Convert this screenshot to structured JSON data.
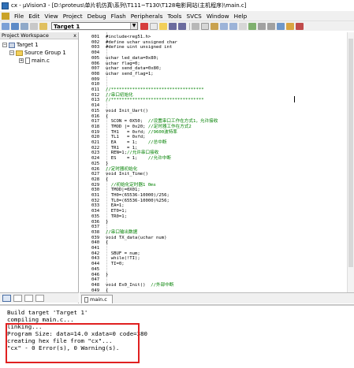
{
  "window": {
    "title": "cx - µVision3 - [D:\\proteus\\单片机仿真\\系列\\T111~T130\\T128电影网站(主机程序)\\main.c]"
  },
  "menu": [
    {
      "label": "File"
    },
    {
      "label": "Edit"
    },
    {
      "label": "View"
    },
    {
      "label": "Project"
    },
    {
      "label": "Debug"
    },
    {
      "label": "Flash"
    },
    {
      "label": "Peripherals"
    },
    {
      "label": "Tools"
    },
    {
      "label": "SVCS"
    },
    {
      "label": "Window"
    },
    {
      "label": "Help"
    }
  ],
  "toolbar": {
    "target_value": "Target 1"
  },
  "project_pane": {
    "header": "Project Workspace",
    "close_glyph": "x",
    "tree": [
      {
        "label": "Target 1",
        "level": 0,
        "expanded": true
      },
      {
        "label": "Source Group 1",
        "level": 1,
        "expanded": true
      },
      {
        "label": "main.c",
        "level": 2,
        "expanded": false
      }
    ]
  },
  "editor": {
    "lines": [
      {
        "no": "001",
        "text": "#include<reg51.h>"
      },
      {
        "no": "002",
        "text": "#define uchar unsigned char"
      },
      {
        "no": "003",
        "text": "#define uint unsigned int"
      },
      {
        "no": "004",
        "text": ""
      },
      {
        "no": "005",
        "text": "uchar led_data=0x80;"
      },
      {
        "no": "006",
        "text": "uchar flag=0;"
      },
      {
        "no": "007",
        "text": "uchar send_data=0x80;"
      },
      {
        "no": "008",
        "text": "uchar send_flag=1;"
      },
      {
        "no": "009",
        "text": ""
      },
      {
        "no": "010",
        "text": ""
      },
      {
        "no": "011",
        "text": "//***********************************"
      },
      {
        "no": "012",
        "text": "//串口初始化"
      },
      {
        "no": "013",
        "text": "//***********************************"
      },
      {
        "no": "014",
        "text": ""
      },
      {
        "no": "015",
        "text": "void Init_Uart()"
      },
      {
        "no": "016",
        "text": "{"
      },
      {
        "no": "017",
        "text": "  SCON = 0X50;  //设置串口工作在方式1，允许接收"
      },
      {
        "no": "018",
        "text": "  TMOD |= 0x20; //定时器工作在方式2"
      },
      {
        "no": "019",
        "text": "  TH1   = 0xfd; //9600波特率"
      },
      {
        "no": "020",
        "text": "  TL1   = 0xfd;"
      },
      {
        "no": "021",
        "text": "  EA    = 1;    //总中断"
      },
      {
        "no": "022",
        "text": "  TR1   = 1;"
      },
      {
        "no": "023",
        "text": "  REN=1;//允许串口接收"
      },
      {
        "no": "024",
        "text": "  ES    = 1;    //允许中断"
      },
      {
        "no": "025",
        "text": "}"
      },
      {
        "no": "026",
        "text": "//定时器初始化"
      },
      {
        "no": "027",
        "text": "void Init_Time()"
      },
      {
        "no": "028",
        "text": "{"
      },
      {
        "no": "029",
        "text": "  //初始化定时器1 0ms"
      },
      {
        "no": "030",
        "text": "  TMOD|=0X01;"
      },
      {
        "no": "031",
        "text": "  TH0=(65536-10000)/256;"
      },
      {
        "no": "032",
        "text": "  TL0=(65536-10000)%256;"
      },
      {
        "no": "033",
        "text": "  EA=1;"
      },
      {
        "no": "034",
        "text": "  ET0=1;"
      },
      {
        "no": "035",
        "text": "  TR0=1;"
      },
      {
        "no": "036",
        "text": "}"
      },
      {
        "no": "037",
        "text": ""
      },
      {
        "no": "038",
        "text": "//串口输出数据"
      },
      {
        "no": "039",
        "text": "void TX_data(uchar num)"
      },
      {
        "no": "040",
        "text": "{"
      },
      {
        "no": "041",
        "text": ""
      },
      {
        "no": "042",
        "text": "  SBUF = num;"
      },
      {
        "no": "043",
        "text": "  while(!TI);"
      },
      {
        "no": "044",
        "text": "  TI=0;"
      },
      {
        "no": "045",
        "text": ""
      },
      {
        "no": "046",
        "text": "}"
      },
      {
        "no": "047",
        "text": ""
      },
      {
        "no": "048",
        "text": "void Ex0_Init()  //外部中断"
      },
      {
        "no": "049",
        "text": "{"
      }
    ],
    "tab_label": "main.c"
  },
  "build_output": [
    "Build target 'Target 1'",
    "compiling main.c...",
    "linking...",
    "Program Size: data=14.0 xdata=0 code=380",
    "creating hex file from \"cx\"...",
    "\"cx\" - 0 Error(s), 0 Warning(s)."
  ],
  "colors": {
    "comment": "#008000",
    "highlight_box": "#e02020"
  }
}
